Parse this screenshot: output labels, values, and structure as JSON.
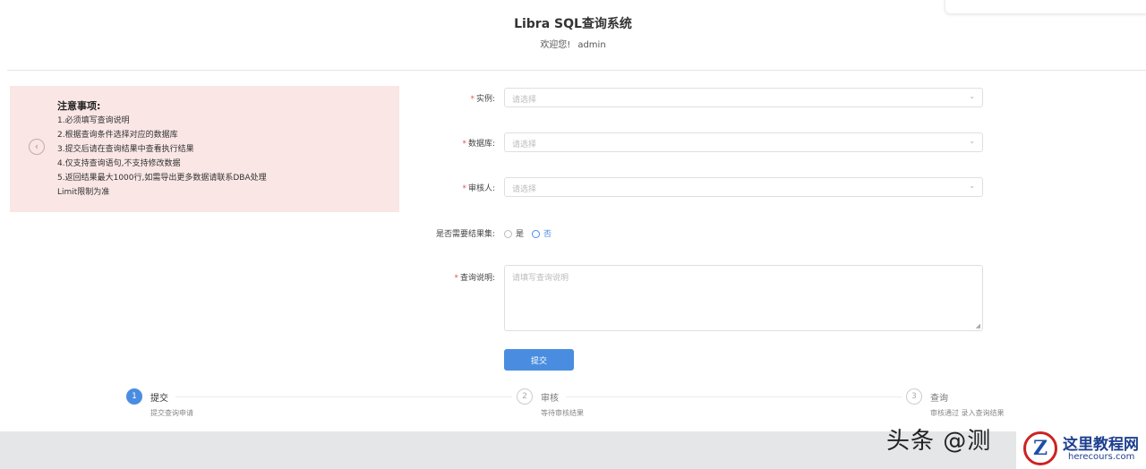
{
  "header": {
    "title": "Libra SQL查询系统",
    "user_label": "欢迎您!",
    "user_name": "admin"
  },
  "notice": {
    "title": "注意事项:",
    "items": [
      "1.必须填写查询说明",
      "2.根据查询条件选择对应的数据库",
      "3.提交后请在查询结果中查看执行结果",
      "4.仅支持查询语句,不支持修改数据",
      "5.返回结果最大1000行,如需导出更多数据请联系DBA处理",
      "Limit限制为准"
    ]
  },
  "form": {
    "field1": {
      "label": "实例:",
      "placeholder": "请选择"
    },
    "field2": {
      "label": "数据库:",
      "placeholder": "请选择"
    },
    "field3": {
      "label": "审核人:",
      "placeholder": "请选择"
    },
    "radio": {
      "label": "是否需要结果集:",
      "option_no": "是",
      "option_yes": "否"
    },
    "description": {
      "label": "查询说明:",
      "placeholder": "请填写查询说明"
    },
    "submit_label": "提交"
  },
  "steps": [
    {
      "num": "1",
      "title": "提交",
      "desc": "提交查询申请"
    },
    {
      "num": "2",
      "title": "审核",
      "desc": "等待审核结果"
    },
    {
      "num": "3",
      "title": "查询",
      "desc": "审核通过 录入查询结果"
    }
  ],
  "watermark": {
    "text": "头条 @测",
    "logo_cn": "这里教程网",
    "logo_en": "herecours.com",
    "logo_mark": "Z"
  }
}
